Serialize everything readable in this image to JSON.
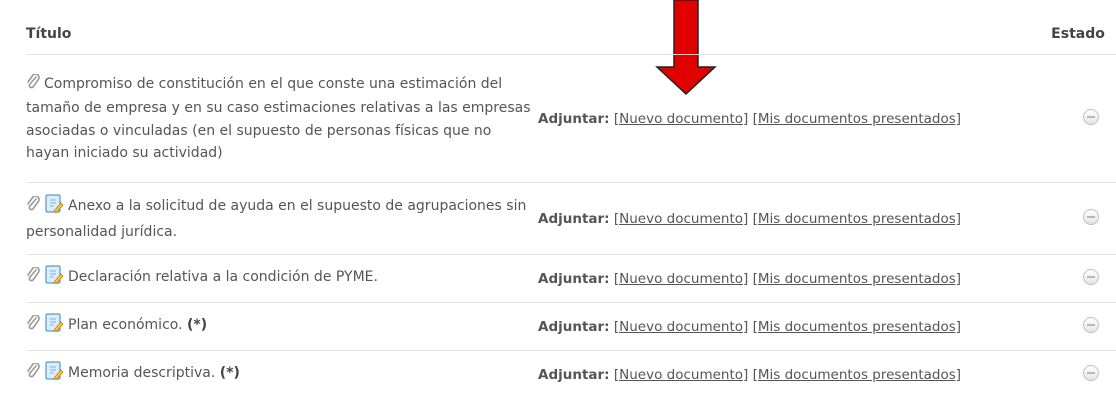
{
  "headers": {
    "titulo": "Título",
    "estado": "Estado"
  },
  "rows": [
    {
      "title": "Compromiso de constitución en el que conste una estimación del tamaño de empresa y en su caso estimaciones relativas a las empresas asociadas o vinculadas (en el supuesto de personas físicas que no hayan iniciado su actividad)",
      "mark": "",
      "has_doc_icon": false,
      "attach_label": "Adjuntar:",
      "new_doc": "[Nuevo documento]",
      "my_docs": "[Mis documentos presentados]"
    },
    {
      "title": "Anexo a la solicitud de ayuda en el supuesto de agrupaciones sin personalidad jurídica.",
      "mark": "",
      "has_doc_icon": true,
      "attach_label": "Adjuntar:",
      "new_doc": "[Nuevo documento]",
      "my_docs": "[Mis documentos presentados]"
    },
    {
      "title": "Declaración relativa a la condición de PYME.",
      "mark": "",
      "has_doc_icon": true,
      "attach_label": "Adjuntar:",
      "new_doc": "[Nuevo documento]",
      "my_docs": "[Mis documentos presentados]"
    },
    {
      "title": "Plan económico.",
      "mark": "(*)",
      "has_doc_icon": true,
      "attach_label": "Adjuntar:",
      "new_doc": "[Nuevo documento]",
      "my_docs": "[Mis documentos presentados]"
    },
    {
      "title": "Memoria descriptiva.",
      "mark": "(*)",
      "has_doc_icon": true,
      "attach_label": "Adjuntar:",
      "new_doc": "[Nuevo documento]",
      "my_docs": "[Mis documentos presentados]"
    }
  ],
  "icons": {
    "clip": "paperclip-icon",
    "doc": "document-edit-icon",
    "status": "status-pending-icon",
    "annotation": "red-down-arrow"
  },
  "colors": {
    "arrow": "#e00000",
    "link": "#555555",
    "divider": "#e6e6e6"
  }
}
